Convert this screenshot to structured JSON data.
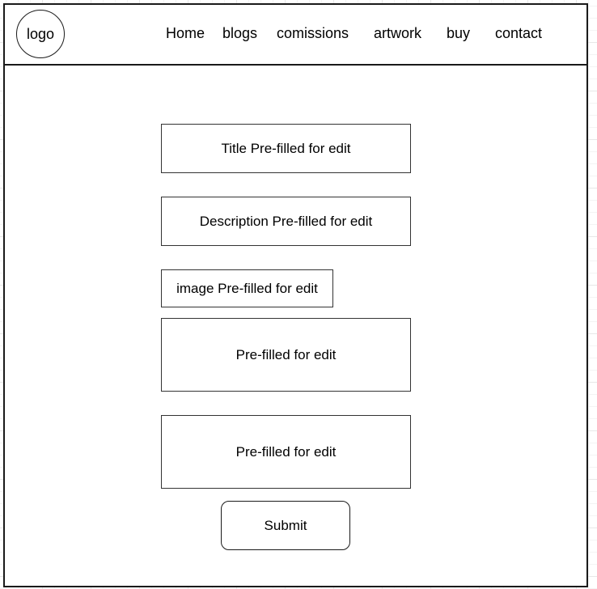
{
  "header": {
    "logo_label": "logo",
    "nav": [
      {
        "label": "Home"
      },
      {
        "label": "blogs"
      },
      {
        "label": "comissions"
      },
      {
        "label": "artwork"
      },
      {
        "label": "buy"
      },
      {
        "label": "contact"
      }
    ]
  },
  "form": {
    "fields": [
      {
        "name": "title",
        "value": "Title Pre-filled for edit"
      },
      {
        "name": "description",
        "value": "Description Pre-filled for edit"
      },
      {
        "name": "image",
        "value": "image Pre-filled for edit"
      },
      {
        "name": "field-4",
        "value": "Pre-filled for edit"
      },
      {
        "name": "field-5",
        "value": "Pre-filled for edit"
      }
    ],
    "submit_label": "Submit"
  }
}
